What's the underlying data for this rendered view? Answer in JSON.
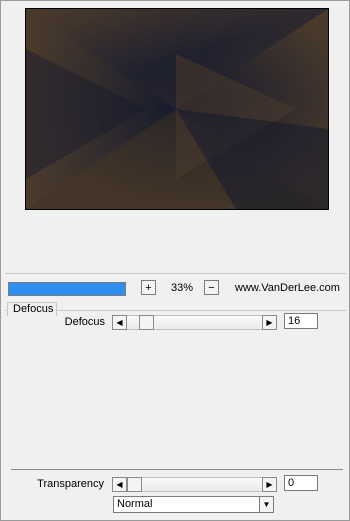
{
  "zoom": {
    "plus_label": "+",
    "minus_label": "−",
    "value": "33%"
  },
  "site_label": "www.VanDerLee.com",
  "progress_fraction": 1.0,
  "group": {
    "title": "Defocus"
  },
  "defocus": {
    "label": "Defocus",
    "value": "16",
    "slider_fraction": 0.1
  },
  "transparency": {
    "label": "Transparency",
    "value": "0",
    "slider_fraction": 0.0
  },
  "blend_mode": {
    "selected": "Normal"
  },
  "icons": {
    "left_arrow": "◀",
    "right_arrow": "▶",
    "dropdown": "▼"
  },
  "colors": {
    "progress": "#2f8ff0",
    "preview_dark": "#14182c",
    "preview_brown": "#4a3a2c"
  }
}
